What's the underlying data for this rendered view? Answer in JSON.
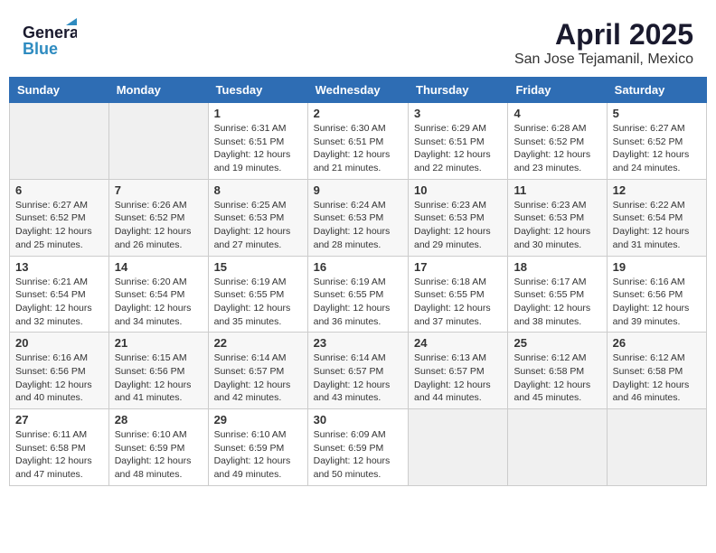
{
  "header": {
    "logo_general": "General",
    "logo_blue": "Blue",
    "month": "April 2025",
    "location": "San Jose Tejamanil, Mexico"
  },
  "columns": [
    "Sunday",
    "Monday",
    "Tuesday",
    "Wednesday",
    "Thursday",
    "Friday",
    "Saturday"
  ],
  "weeks": [
    [
      {
        "day": "",
        "sunrise": "",
        "sunset": "",
        "daylight": ""
      },
      {
        "day": "",
        "sunrise": "",
        "sunset": "",
        "daylight": ""
      },
      {
        "day": "1",
        "sunrise": "Sunrise: 6:31 AM",
        "sunset": "Sunset: 6:51 PM",
        "daylight": "Daylight: 12 hours and 19 minutes."
      },
      {
        "day": "2",
        "sunrise": "Sunrise: 6:30 AM",
        "sunset": "Sunset: 6:51 PM",
        "daylight": "Daylight: 12 hours and 21 minutes."
      },
      {
        "day": "3",
        "sunrise": "Sunrise: 6:29 AM",
        "sunset": "Sunset: 6:51 PM",
        "daylight": "Daylight: 12 hours and 22 minutes."
      },
      {
        "day": "4",
        "sunrise": "Sunrise: 6:28 AM",
        "sunset": "Sunset: 6:52 PM",
        "daylight": "Daylight: 12 hours and 23 minutes."
      },
      {
        "day": "5",
        "sunrise": "Sunrise: 6:27 AM",
        "sunset": "Sunset: 6:52 PM",
        "daylight": "Daylight: 12 hours and 24 minutes."
      }
    ],
    [
      {
        "day": "6",
        "sunrise": "Sunrise: 6:27 AM",
        "sunset": "Sunset: 6:52 PM",
        "daylight": "Daylight: 12 hours and 25 minutes."
      },
      {
        "day": "7",
        "sunrise": "Sunrise: 6:26 AM",
        "sunset": "Sunset: 6:52 PM",
        "daylight": "Daylight: 12 hours and 26 minutes."
      },
      {
        "day": "8",
        "sunrise": "Sunrise: 6:25 AM",
        "sunset": "Sunset: 6:53 PM",
        "daylight": "Daylight: 12 hours and 27 minutes."
      },
      {
        "day": "9",
        "sunrise": "Sunrise: 6:24 AM",
        "sunset": "Sunset: 6:53 PM",
        "daylight": "Daylight: 12 hours and 28 minutes."
      },
      {
        "day": "10",
        "sunrise": "Sunrise: 6:23 AM",
        "sunset": "Sunset: 6:53 PM",
        "daylight": "Daylight: 12 hours and 29 minutes."
      },
      {
        "day": "11",
        "sunrise": "Sunrise: 6:23 AM",
        "sunset": "Sunset: 6:53 PM",
        "daylight": "Daylight: 12 hours and 30 minutes."
      },
      {
        "day": "12",
        "sunrise": "Sunrise: 6:22 AM",
        "sunset": "Sunset: 6:54 PM",
        "daylight": "Daylight: 12 hours and 31 minutes."
      }
    ],
    [
      {
        "day": "13",
        "sunrise": "Sunrise: 6:21 AM",
        "sunset": "Sunset: 6:54 PM",
        "daylight": "Daylight: 12 hours and 32 minutes."
      },
      {
        "day": "14",
        "sunrise": "Sunrise: 6:20 AM",
        "sunset": "Sunset: 6:54 PM",
        "daylight": "Daylight: 12 hours and 34 minutes."
      },
      {
        "day": "15",
        "sunrise": "Sunrise: 6:19 AM",
        "sunset": "Sunset: 6:55 PM",
        "daylight": "Daylight: 12 hours and 35 minutes."
      },
      {
        "day": "16",
        "sunrise": "Sunrise: 6:19 AM",
        "sunset": "Sunset: 6:55 PM",
        "daylight": "Daylight: 12 hours and 36 minutes."
      },
      {
        "day": "17",
        "sunrise": "Sunrise: 6:18 AM",
        "sunset": "Sunset: 6:55 PM",
        "daylight": "Daylight: 12 hours and 37 minutes."
      },
      {
        "day": "18",
        "sunrise": "Sunrise: 6:17 AM",
        "sunset": "Sunset: 6:55 PM",
        "daylight": "Daylight: 12 hours and 38 minutes."
      },
      {
        "day": "19",
        "sunrise": "Sunrise: 6:16 AM",
        "sunset": "Sunset: 6:56 PM",
        "daylight": "Daylight: 12 hours and 39 minutes."
      }
    ],
    [
      {
        "day": "20",
        "sunrise": "Sunrise: 6:16 AM",
        "sunset": "Sunset: 6:56 PM",
        "daylight": "Daylight: 12 hours and 40 minutes."
      },
      {
        "day": "21",
        "sunrise": "Sunrise: 6:15 AM",
        "sunset": "Sunset: 6:56 PM",
        "daylight": "Daylight: 12 hours and 41 minutes."
      },
      {
        "day": "22",
        "sunrise": "Sunrise: 6:14 AM",
        "sunset": "Sunset: 6:57 PM",
        "daylight": "Daylight: 12 hours and 42 minutes."
      },
      {
        "day": "23",
        "sunrise": "Sunrise: 6:14 AM",
        "sunset": "Sunset: 6:57 PM",
        "daylight": "Daylight: 12 hours and 43 minutes."
      },
      {
        "day": "24",
        "sunrise": "Sunrise: 6:13 AM",
        "sunset": "Sunset: 6:57 PM",
        "daylight": "Daylight: 12 hours and 44 minutes."
      },
      {
        "day": "25",
        "sunrise": "Sunrise: 6:12 AM",
        "sunset": "Sunset: 6:58 PM",
        "daylight": "Daylight: 12 hours and 45 minutes."
      },
      {
        "day": "26",
        "sunrise": "Sunrise: 6:12 AM",
        "sunset": "Sunset: 6:58 PM",
        "daylight": "Daylight: 12 hours and 46 minutes."
      }
    ],
    [
      {
        "day": "27",
        "sunrise": "Sunrise: 6:11 AM",
        "sunset": "Sunset: 6:58 PM",
        "daylight": "Daylight: 12 hours and 47 minutes."
      },
      {
        "day": "28",
        "sunrise": "Sunrise: 6:10 AM",
        "sunset": "Sunset: 6:59 PM",
        "daylight": "Daylight: 12 hours and 48 minutes."
      },
      {
        "day": "29",
        "sunrise": "Sunrise: 6:10 AM",
        "sunset": "Sunset: 6:59 PM",
        "daylight": "Daylight: 12 hours and 49 minutes."
      },
      {
        "day": "30",
        "sunrise": "Sunrise: 6:09 AM",
        "sunset": "Sunset: 6:59 PM",
        "daylight": "Daylight: 12 hours and 50 minutes."
      },
      {
        "day": "",
        "sunrise": "",
        "sunset": "",
        "daylight": ""
      },
      {
        "day": "",
        "sunrise": "",
        "sunset": "",
        "daylight": ""
      },
      {
        "day": "",
        "sunrise": "",
        "sunset": "",
        "daylight": ""
      }
    ]
  ]
}
